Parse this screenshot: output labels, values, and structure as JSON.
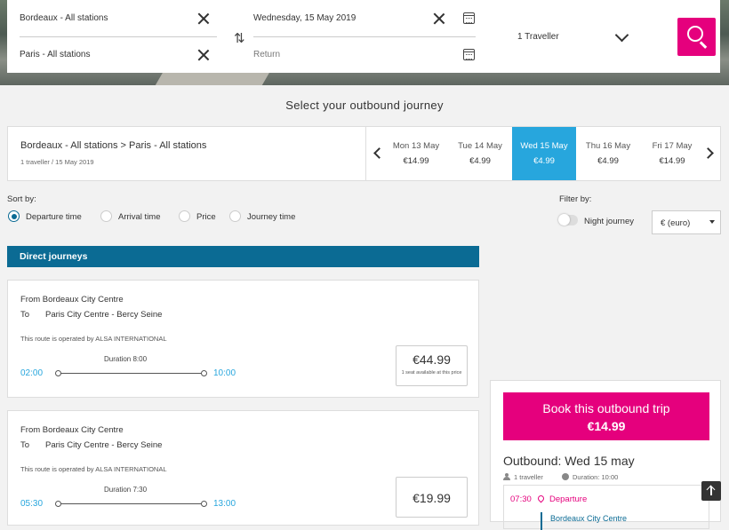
{
  "search": {
    "origin": "Bordeaux - All stations",
    "destination": "Paris - All stations",
    "outbound_date": "Wednesday, 15 May 2019",
    "return_placeholder": "Return",
    "travellers": "1 Traveller"
  },
  "section_title": "Select your outbound journey",
  "route": {
    "title": "Bordeaux - All stations > Paris - All stations",
    "subtitle": "1 traveller / 15 May 2019"
  },
  "dates": [
    {
      "day": "Mon 13 May",
      "price": "€14.99",
      "selected": false
    },
    {
      "day": "Tue 14 May",
      "price": "€4.99",
      "selected": false
    },
    {
      "day": "Wed 15 May",
      "price": "€4.99",
      "selected": true
    },
    {
      "day": "Thu 16 May",
      "price": "€4.99",
      "selected": false
    },
    {
      "day": "Fri 17 May",
      "price": "€14.99",
      "selected": false
    }
  ],
  "sort": {
    "label": "Sort by:",
    "options": [
      "Departure time",
      "Arrival time",
      "Price",
      "Journey time"
    ],
    "selected": "Departure time"
  },
  "filter": {
    "label": "Filter by:",
    "night_journey": "Night journey",
    "currency": "€ (euro)"
  },
  "direct_label": "Direct journeys",
  "journeys": [
    {
      "from": "From Bordeaux City Centre",
      "to_label": "To",
      "to": "Paris City Centre - Bercy Seine",
      "operator": "This route is operated by ALSA INTERNATIONAL",
      "duration": "Duration 8:00",
      "departure": "02:00",
      "arrival": "10:00",
      "price": "€44.99",
      "note": "1 seat available at this price"
    },
    {
      "from": "From Bordeaux City Centre",
      "to_label": "To",
      "to": "Paris City Centre - Bercy Seine",
      "operator": "This route is operated by ALSA INTERNATIONAL",
      "duration": "Duration 7:30",
      "departure": "05:30",
      "arrival": "13:00",
      "price": "€19.99",
      "note": ""
    }
  ],
  "booking": {
    "button_line1": "Book this outbound trip",
    "button_line2": "€14.99",
    "outbound_title": "Outbound: Wed 15 may",
    "travellers": "1 traveller",
    "duration": "Duration: 10:00",
    "dep_time": "07:30",
    "dep_label": "Departure",
    "dep_station": "Bordeaux City Centre"
  },
  "colors": {
    "accent": "#e5007d",
    "primary": "#0b6b94",
    "selected_date": "#27a6dd"
  }
}
